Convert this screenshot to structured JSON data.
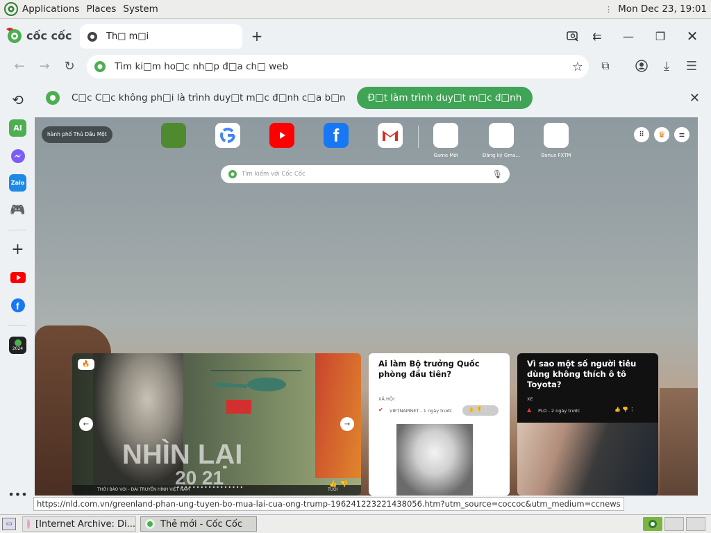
{
  "topbar": {
    "applications": "Applications",
    "places": "Places",
    "system": "System",
    "clock": "Mon Dec 23, 19:01"
  },
  "browser": {
    "brand": "cốc cốc",
    "tab_title": "Th□ m□i",
    "address_placeholder": "Tìm ki□m ho□c nh□p đ□a ch□ web"
  },
  "infobar": {
    "message": "C□c C□c không ph□i là trình duy□t m□c đ□nh c□a b□n",
    "button": "Đ□t làm trình duy□t m□c đ□nh"
  },
  "sidebar": {
    "ai_label": "AI",
    "zalo_label": "Zalo",
    "year_label": "2024"
  },
  "newtab": {
    "location": "hành phố Thủ Dầu Một",
    "search_placeholder": "Tìm kiếm với Cốc Cốc",
    "dials": [
      {
        "label": "Game Mới"
      },
      {
        "label": "Đăng ký Gma..."
      },
      {
        "label": "Bonus FXTM"
      }
    ],
    "hero": {
      "overlay_text": "NHÌN LẠI",
      "year_fragment": "20 21",
      "source_strip": "THỜI BÁO VOI - ĐÀI TRUYỀN HÌNH VIỆT NAM",
      "source_right": "TUỔI"
    },
    "articles": [
      {
        "title": "Ai làm Bộ trưởng Quốc phòng đầu tiên?",
        "category": "XÃ HỘI",
        "source": "VIETNAMNET - 1 ngày trước"
      },
      {
        "title": "Vì sao một số người tiêu dùng không thích ô tô Toyota?",
        "category": "XE",
        "source": "PLO - 2 ngày trước"
      }
    ]
  },
  "status_url": "https://nld.com.vn/greenland-phan-ung-tuyen-bo-mua-lai-cua-ong-trump-196241223221438056.htm?utm_source=coccoc&utm_medium=ccnews",
  "taskbar": {
    "items": [
      "[Internet Archive: Di...",
      "Thẻ mới - Cốc Cốc"
    ]
  }
}
